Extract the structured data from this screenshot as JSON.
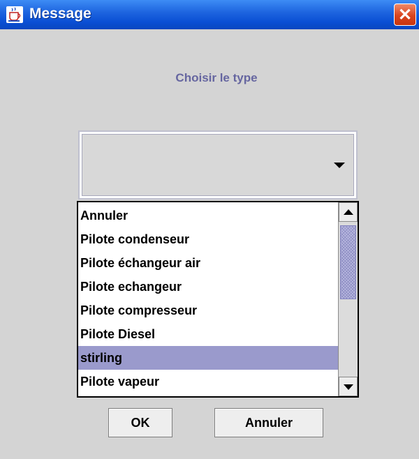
{
  "window": {
    "title": "Message",
    "icon": "java-cup-icon",
    "close_glyph": "✕"
  },
  "prompt": "Choisir le type",
  "combo": {
    "selected_value": "",
    "arrow_icon": "triangle-down-icon"
  },
  "list": {
    "items": [
      "Annuler",
      "Pilote condenseur",
      "Pilote échangeur air",
      "Pilote echangeur",
      "Pilote compresseur",
      "Pilote Diesel",
      "stirling",
      "Pilote vapeur"
    ],
    "selected_item": "stirling"
  },
  "buttons": {
    "ok_label": "OK",
    "cancel_label": "Annuler"
  },
  "colors": {
    "titlebar": "#0a4fd4",
    "background": "#d4d4d4",
    "selection": "#9a9acc",
    "prompt_text": "#6666a0",
    "close_button": "#d9441e"
  }
}
